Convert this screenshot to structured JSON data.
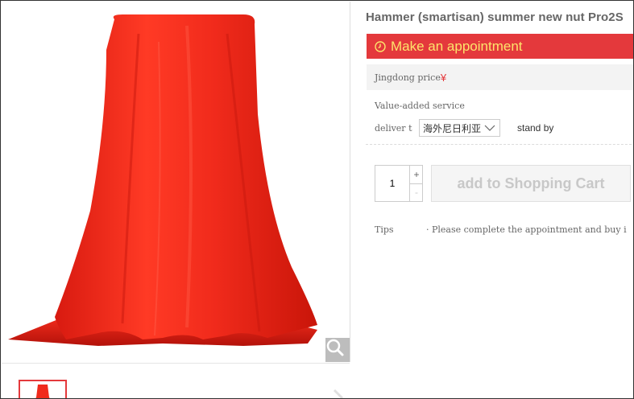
{
  "product": {
    "title": "Hammer (smartisan) summer new nut Pro2S",
    "appointment_label": "Make an appointment",
    "price_label": "Jingdong price",
    "currency_symbol": "¥",
    "value_added_label": "Value-added service",
    "deliver_label": "deliver t",
    "deliver_region": "海外尼日利亚",
    "stand_by_label": "stand by",
    "quantity": "1",
    "qty_plus": "+",
    "qty_minus": "-",
    "cart_label": "add to Shopping Cart",
    "tips_label": "Tips",
    "tips_text": "· Please complete the appointment and buy i"
  },
  "icons": {
    "zoom": "magnifier-icon",
    "clock": "clock-icon",
    "chevron": "chevron-down-icon"
  },
  "colors": {
    "accent_red": "#e4393c",
    "appointment_text": "#fde46b",
    "cloth_red": "#f02a1c"
  }
}
